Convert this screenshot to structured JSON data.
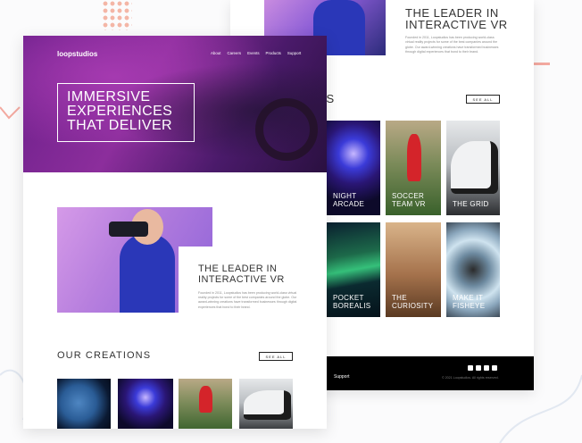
{
  "back_page": {
    "leader_title": "THE LEADER IN INTERACTIVE VR",
    "leader_body": "Founded in 2011, Loopstudios has been producing world-class virtual reality projects for some of the best companies around the globe. Our award-winning creations have transformed businesses through digital experiences that bond to their brand.",
    "creations_heading_partial": "ONS",
    "see_all": "SEE ALL",
    "cards": [
      {
        "caption": "NIGHT ARCADE",
        "style": "arcade"
      },
      {
        "caption": "SOCCER TEAM VR",
        "style": "soccer"
      },
      {
        "caption": "THE GRID",
        "style": "grid"
      },
      {
        "caption": "POCKET BOREALIS",
        "style": "aurora"
      },
      {
        "caption": "THE CURIOSITY",
        "style": "curiosity"
      },
      {
        "caption": "MAKE IT FISHEYE",
        "style": "fisheye"
      }
    ],
    "footer_link": "Support",
    "copyright": "© 2021 Loopstudios. All rights reserved."
  },
  "front_page": {
    "logo": "loopstudios",
    "nav": [
      "About",
      "Careers",
      "Events",
      "Products",
      "Support"
    ],
    "hero_lines": [
      "IMMERSIVE",
      "EXPERIENCES",
      "THAT DELIVER"
    ],
    "leader_title": "THE LEADER IN INTERACTIVE VR",
    "leader_body": "Founded in 2011, Loopstudios has been producing world-class virtual reality projects for some of the best companies around the globe. Our award-winning creations have transformed businesses through digital experiences that bond to their brand.",
    "our_creations": "OUR CREATIONS",
    "see_all": "SEE ALL",
    "thumbs": [
      "earth",
      "arcade",
      "soccer",
      "grid"
    ]
  },
  "colors": {
    "accent_pink": "#f3a9a0",
    "footer_bg": "#000000",
    "text_dark": "#333333"
  }
}
